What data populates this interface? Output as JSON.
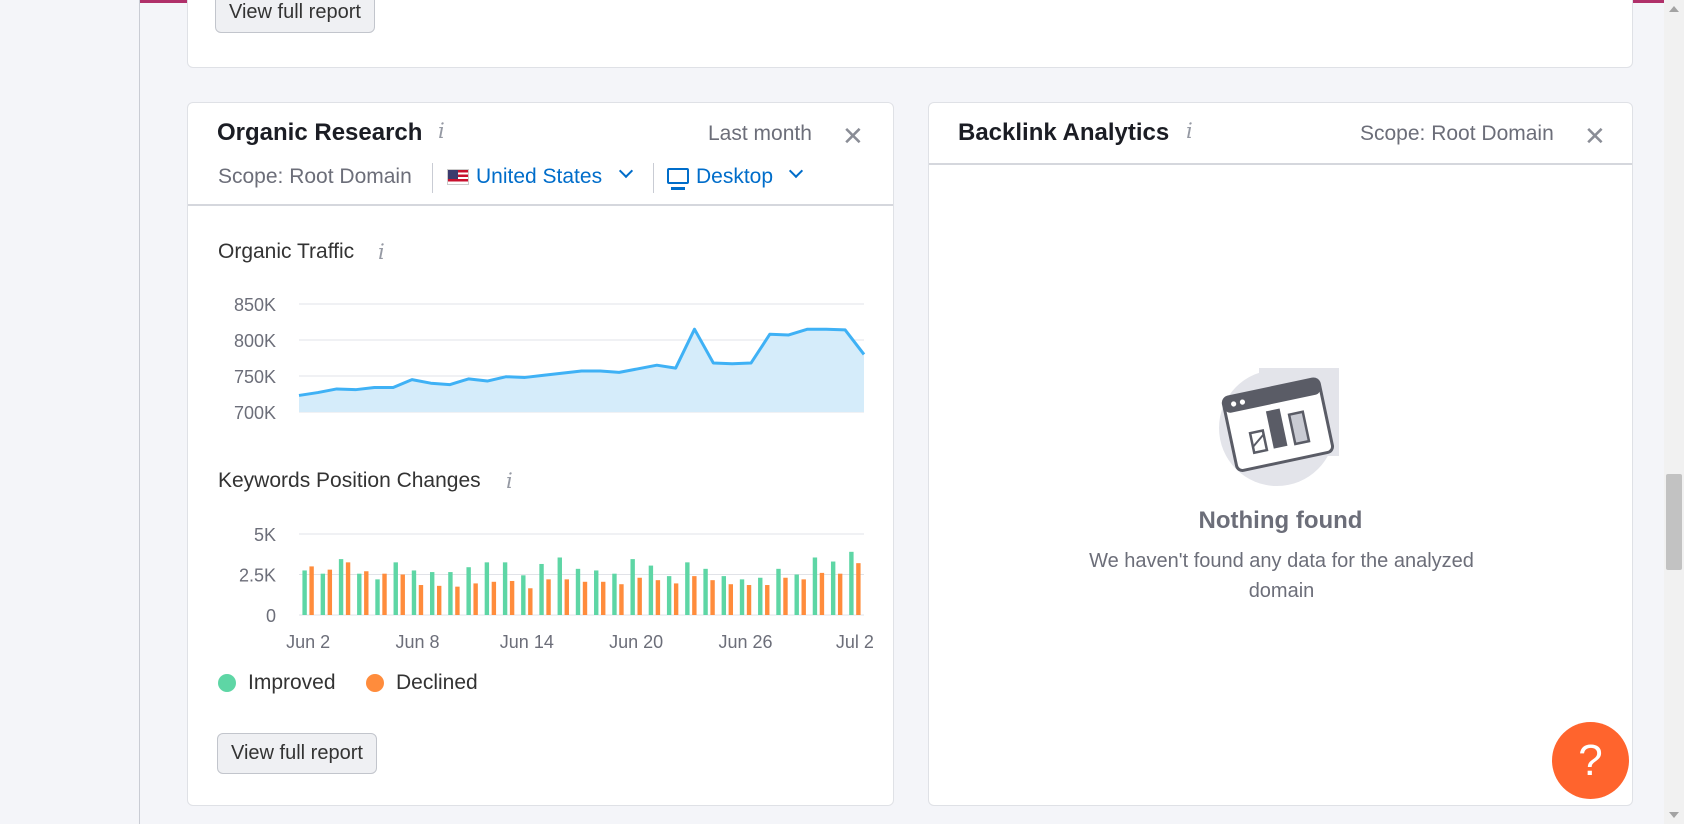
{
  "top_card": {
    "view_full_report": "View full report"
  },
  "organic": {
    "title": "Organic Research",
    "period": "Last month",
    "scope": "Scope: Root Domain",
    "country": "United States",
    "device": "Desktop",
    "view_full_report": "View full report",
    "traffic_title": "Organic Traffic",
    "keywords_title": "Keywords Position Changes",
    "legend": {
      "improved": "Improved",
      "declined": "Declined"
    }
  },
  "backlink": {
    "title": "Backlink Analytics",
    "scope": "Scope: Root Domain",
    "empty_title": "Nothing found",
    "empty_desc": "We haven't found any data for the analyzed domain"
  },
  "help": {
    "label": "?"
  },
  "colors": {
    "improved": "#5ed6a5",
    "declined": "#ff8c3c",
    "traffic_line": "#3fb1f5",
    "traffic_fill": "#d5ecfa",
    "link": "#006dca",
    "help": "#ff642d"
  },
  "icons": {
    "close": "close-icon",
    "info": "info-icon",
    "flag": "us-flag-icon",
    "device": "desktop-icon",
    "chevron": "chevron-down-icon",
    "empty": "empty-report-illustration"
  },
  "chart_data": [
    {
      "type": "area",
      "title": "Organic Traffic",
      "yticks": [
        "700K",
        "750K",
        "800K",
        "850K"
      ],
      "ylim": [
        700000,
        850000
      ],
      "grid": true,
      "values": [
        723000,
        727000,
        732000,
        731000,
        734000,
        734000,
        745000,
        740000,
        738000,
        746000,
        743000,
        749000,
        748000,
        751000,
        754000,
        757000,
        757000,
        755000,
        760000,
        765000,
        761000,
        815000,
        768000,
        767000,
        768000,
        808000,
        807000,
        815000,
        815000,
        814000,
        780000
      ]
    },
    {
      "type": "bar",
      "title": "Keywords Position Changes",
      "yticks": [
        "0",
        "2.5K",
        "5K"
      ],
      "ylim": [
        0,
        5000
      ],
      "grid": true,
      "xtick_labels": [
        "Jun 2",
        "Jun 8",
        "Jun 14",
        "Jun 20",
        "Jun 26",
        "Jul 2"
      ],
      "xtick_index": [
        1,
        7,
        13,
        19,
        25,
        31
      ],
      "legend_position": "bottom-left",
      "series": [
        {
          "name": "Improved",
          "values": [
            2750,
            2550,
            3450,
            2550,
            2200,
            3250,
            2750,
            2650,
            2650,
            2950,
            3250,
            3250,
            2450,
            3150,
            3550,
            2850,
            2750,
            2550,
            3450,
            3050,
            2400,
            3250,
            2850,
            2400,
            2200,
            2300,
            2850,
            2500,
            3550,
            3300,
            3900
          ]
        },
        {
          "name": "Declined",
          "values": [
            3000,
            2800,
            3250,
            2700,
            2550,
            2500,
            1850,
            1800,
            1750,
            1950,
            2050,
            2100,
            1650,
            2200,
            2200,
            2050,
            2050,
            1900,
            2300,
            2150,
            1950,
            2400,
            2150,
            1900,
            1850,
            1850,
            2300,
            2200,
            2600,
            2550,
            3200
          ]
        }
      ]
    }
  ]
}
